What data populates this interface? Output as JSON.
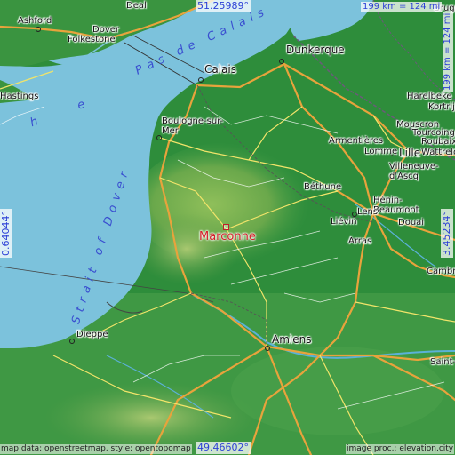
{
  "map": {
    "location": {
      "name": "Marconne"
    },
    "coords": {
      "north": "51.25989°",
      "south": "49.46602°",
      "west": "0.64044°",
      "east": "3.45234°"
    },
    "scale": {
      "horizontal": "199 km = 124 mi",
      "vertical": "199 km = 124 mi"
    },
    "credits": {
      "left": "map data: openstreetmap, style: opentopomap",
      "right": "image proc.: elevation.city"
    },
    "sea_labels": {
      "pas_de_calais": "Pas de Calais",
      "strait_of_dover": "Strait of Dover",
      "channel": "h e"
    },
    "cities": [
      {
        "id": "ashford",
        "name": "Ashford"
      },
      {
        "id": "deal",
        "name": "Deal"
      },
      {
        "id": "dover",
        "name": "Dover"
      },
      {
        "id": "folkestone",
        "name": "Folkestone"
      },
      {
        "id": "hastings",
        "name": "Hastings"
      },
      {
        "id": "calais",
        "name": "Calais"
      },
      {
        "id": "dunkerque",
        "name": "Dunkerque"
      },
      {
        "id": "boulogne",
        "name": "Boulogne-sur-\nMer"
      },
      {
        "id": "lille",
        "name": "Lille"
      },
      {
        "id": "armentieres",
        "name": "Armentières"
      },
      {
        "id": "harelbeke",
        "name": "Harelbeke"
      },
      {
        "id": "kortrijk",
        "name": "Kortrijk"
      },
      {
        "id": "mouscron",
        "name": "Mouscron"
      },
      {
        "id": "tourcoing",
        "name": "Tourcoing"
      },
      {
        "id": "roubaix",
        "name": "Roubaix"
      },
      {
        "id": "wattrelos",
        "name": "Wattrelos"
      },
      {
        "id": "lomme",
        "name": "Lomme"
      },
      {
        "id": "villeneuve",
        "name": "Villeneuve-\nd'Ascq"
      },
      {
        "id": "bethune",
        "name": "Béthune"
      },
      {
        "id": "henin",
        "name": "Hénin-\nBeaumont"
      },
      {
        "id": "lens",
        "name": "Lens"
      },
      {
        "id": "lievin",
        "name": "Liévin"
      },
      {
        "id": "douai",
        "name": "Douai"
      },
      {
        "id": "arras",
        "name": "Arras"
      },
      {
        "id": "cambrai",
        "name": "Cambra"
      },
      {
        "id": "amiens",
        "name": "Amiens"
      },
      {
        "id": "dieppe",
        "name": "Dieppe"
      },
      {
        "id": "saint",
        "name": "Saint-"
      },
      {
        "id": "brugge",
        "name": "Brugg"
      }
    ]
  }
}
